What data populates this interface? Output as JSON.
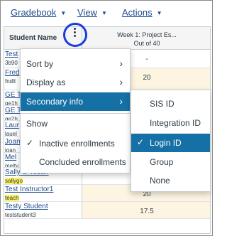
{
  "top_menu": [
    {
      "label": "Gradebook"
    },
    {
      "label": "View"
    },
    {
      "label": "Actions"
    }
  ],
  "grid": {
    "name_header": "Student Name",
    "assignment_header_line1": "Week 1: Project Es...",
    "assignment_header_line2": "Out of 40",
    "rows": [
      {
        "name": "Test",
        "sub": "3b90",
        "grade": "-",
        "highlight_sub": false
      },
      {
        "name": "Fred",
        "sub": "fndlt",
        "grade": "20",
        "highlight_sub": false
      },
      {
        "name": "GE T",
        "sub": "ge1h",
        "grade": "",
        "highlight_sub": false
      },
      {
        "name": "GE T",
        "sub": "ge2h",
        "grade": "",
        "highlight_sub": false
      },
      {
        "name": "Laur",
        "sub": "lauel",
        "grade": "",
        "highlight_sub": false
      },
      {
        "name": "Joan",
        "sub": "joan",
        "grade": "",
        "highlight_sub": false
      },
      {
        "name": "Mel",
        "sub": "melty",
        "grade": "",
        "highlight_sub": false
      },
      {
        "name": "Sally S-Tester",
        "sub": "sallygo",
        "grade": "",
        "highlight_sub": true
      },
      {
        "name": "Test Instructor1",
        "sub": "teach",
        "grade": "20",
        "highlight_sub": true
      },
      {
        "name": "Testy Student",
        "sub": "teststudent3",
        "grade": "17.5",
        "highlight_sub": false
      }
    ]
  },
  "column_menu": {
    "items": [
      {
        "label": "Sort by",
        "arrow": "›"
      },
      {
        "label": "Display as",
        "arrow": "›"
      },
      {
        "label": "Secondary info",
        "arrow": "›"
      }
    ],
    "show_heading": "Show",
    "show_items": [
      {
        "label": "Inactive enrollments",
        "check": "✓"
      },
      {
        "label": "Concluded enrollments",
        "check": ""
      }
    ]
  },
  "secondary_info_menu": {
    "items": [
      {
        "label": "SIS ID",
        "check": ""
      },
      {
        "label": "Integration ID",
        "check": ""
      },
      {
        "label": "Login ID",
        "check": "✓"
      },
      {
        "label": "Group",
        "check": ""
      },
      {
        "label": "None",
        "check": ""
      }
    ]
  },
  "colors": {
    "link": "#1f4e8c",
    "menu_active": "#1570a6",
    "highlight": "#fff35c",
    "kebab_circle": "#1a3ce0",
    "grade_tint": "#fdf5e1"
  },
  "icons": {
    "kebab": "more-options-icon",
    "dropdown": "caret-down-icon",
    "submenu": "chevron-right-icon",
    "check": "checkmark-icon"
  }
}
